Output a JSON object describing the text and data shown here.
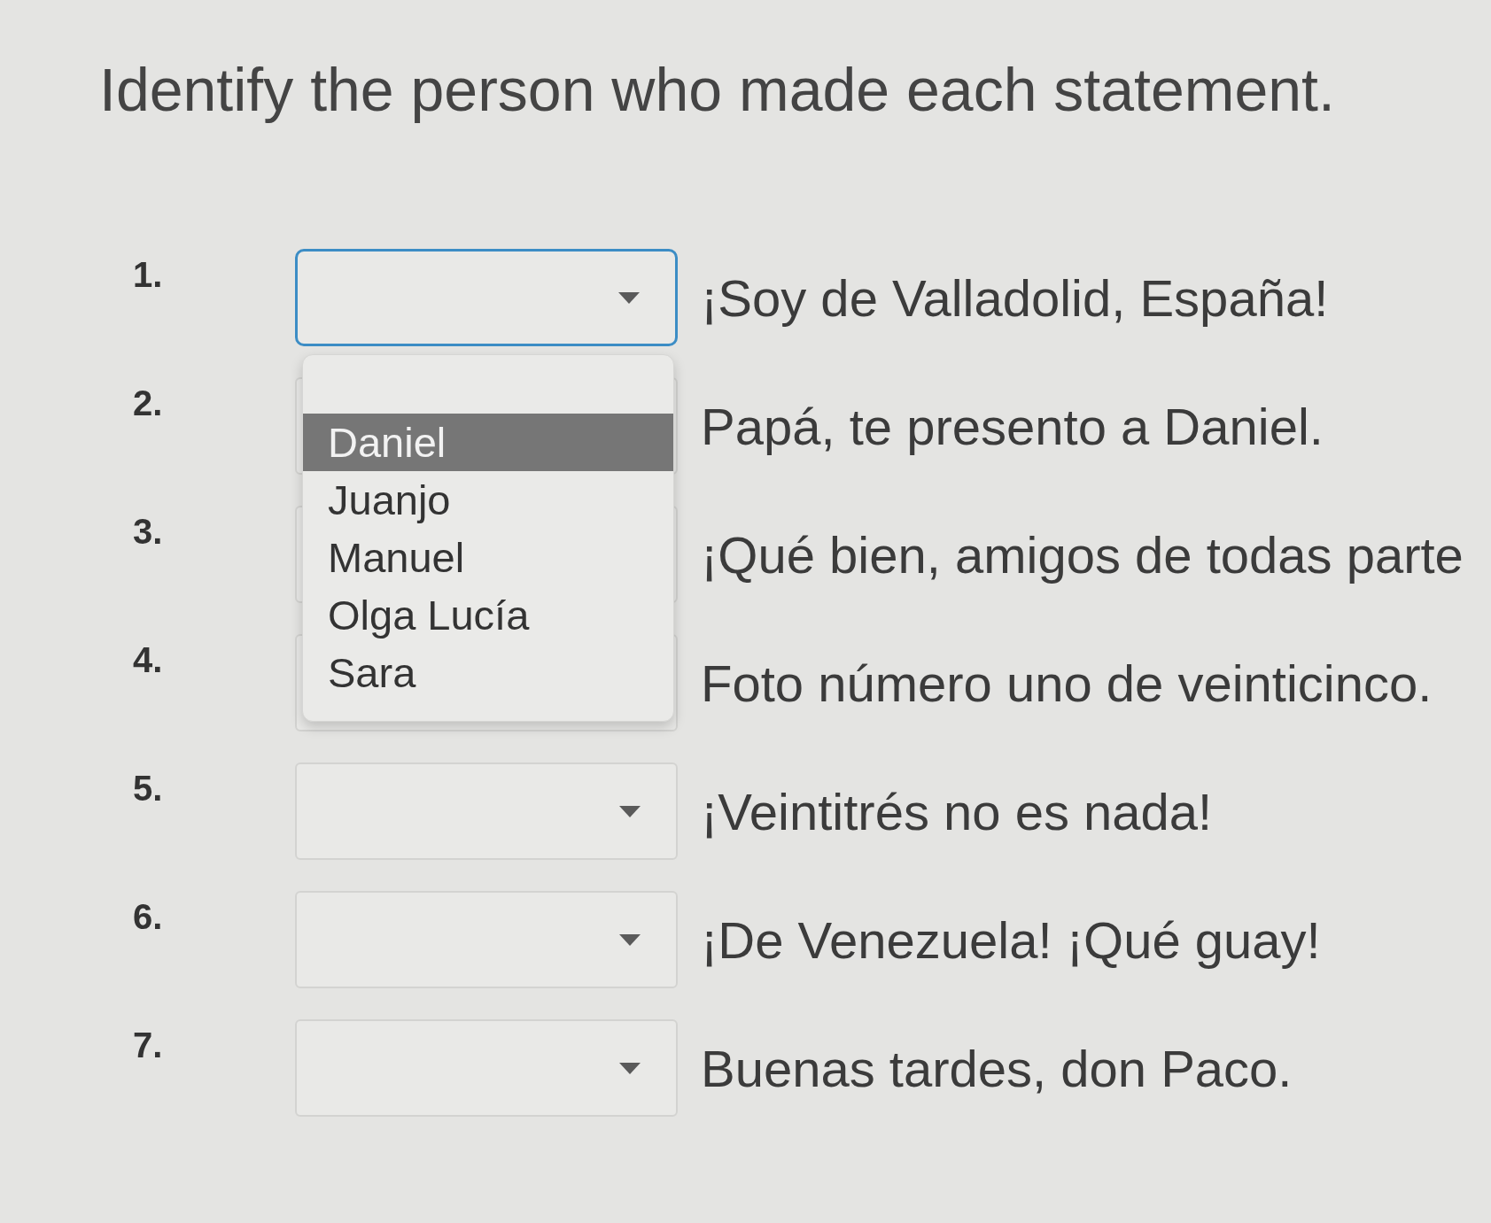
{
  "title": "Identify the person who made each statement.",
  "questions": [
    {
      "number": "1.",
      "statement": "¡Soy de Valladolid, España!",
      "focused": true,
      "expanded": true,
      "options": [
        {
          "label": "Daniel",
          "selected": true
        },
        {
          "label": "Juanjo",
          "selected": false
        },
        {
          "label": "Manuel",
          "selected": false
        },
        {
          "label": "Olga Lucía",
          "selected": false
        },
        {
          "label": "Sara",
          "selected": false
        }
      ]
    },
    {
      "number": "2.",
      "statement": "Papá, te presento a Daniel.",
      "focused": false,
      "expanded": false
    },
    {
      "number": "3.",
      "statement": "¡Qué bien, amigos de todas parte",
      "focused": false,
      "expanded": false
    },
    {
      "number": "4.",
      "statement": "Foto número uno de veinticinco.",
      "focused": false,
      "expanded": false
    },
    {
      "number": "5.",
      "statement": "¡Veintitrés no es nada!",
      "focused": false,
      "expanded": false
    },
    {
      "number": "6.",
      "statement": "¡De Venezuela! ¡Qué guay!",
      "focused": false,
      "expanded": false
    },
    {
      "number": "7.",
      "statement": "Buenas tardes, don Paco.",
      "focused": false,
      "expanded": false
    }
  ]
}
